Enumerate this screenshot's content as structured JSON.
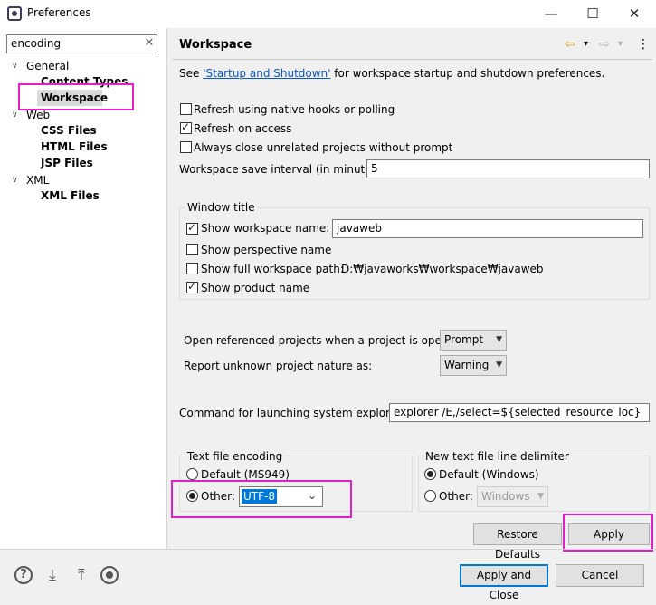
{
  "window": {
    "title": "Preferences",
    "minimize": "—",
    "maximize": "☐",
    "close": "✕"
  },
  "filter": {
    "value": "encoding",
    "clear": "✕"
  },
  "tree": {
    "general": "General",
    "content_types": "Content Types",
    "workspace": "Workspace",
    "web": "Web",
    "css_files": "CSS Files",
    "html_files": "HTML Files",
    "jsp_files": "JSP Files",
    "xml": "XML",
    "xml_files": "XML Files",
    "expanded_glyph": "∨"
  },
  "page": {
    "title": "Workspace",
    "see_prefix": "See ",
    "see_link": "'Startup and Shutdown'",
    "see_suffix": " for workspace startup and shutdown preferences.",
    "nav_back": "⇦",
    "nav_forward": "⇨",
    "menu_glyph": "⋮",
    "dropdown_glyph": "▾"
  },
  "options": {
    "refresh_native": {
      "label": "Refresh using native hooks or polling",
      "checked": false
    },
    "refresh_access": {
      "label": "Refresh on access",
      "checked": true
    },
    "close_unrelated": {
      "label": "Always close unrelated projects without prompt",
      "checked": false
    },
    "save_interval_label": "Workspace save interval (in minutes):",
    "save_interval_value": "5"
  },
  "window_title_group": {
    "legend": "Window title",
    "show_workspace_name": {
      "label": "Show workspace name:",
      "checked": true,
      "value": "javaweb"
    },
    "show_perspective_name": {
      "label": "Show perspective name",
      "checked": false
    },
    "show_full_path": {
      "label": "Show full workspace path:",
      "checked": false,
      "value": "D:₩javaworks₩workspace₩javaweb"
    },
    "show_product_name": {
      "label": "Show product name",
      "checked": true
    }
  },
  "projects": {
    "open_referenced_label": "Open referenced projects when a project is opened:",
    "open_referenced_value": "Prompt",
    "report_unknown_label": "Report unknown project nature as:",
    "report_unknown_value": "Warning"
  },
  "explorer": {
    "label": "Command for launching system explorer:",
    "value": "explorer /E,/select=${selected_resource_loc}"
  },
  "encoding": {
    "legend": "Text file encoding",
    "default_label": "Default (MS949)",
    "other_label": "Other:",
    "other_value": "UTF-8",
    "selected": "other"
  },
  "line_delimiter": {
    "legend": "New text file line delimiter",
    "default_label": "Default (Windows)",
    "other_label": "Other:",
    "other_value": "Windows",
    "selected": "default"
  },
  "buttons": {
    "restore_defaults": "Restore Defaults",
    "apply": "Apply",
    "apply_and_close": "Apply and Close",
    "cancel": "Cancel"
  },
  "icons": [
    "help-icon",
    "import-icon",
    "export-icon",
    "record-icon"
  ],
  "colors": {
    "highlight": "#e020c8",
    "link": "#0b57c4",
    "selection": "#0078d7"
  }
}
